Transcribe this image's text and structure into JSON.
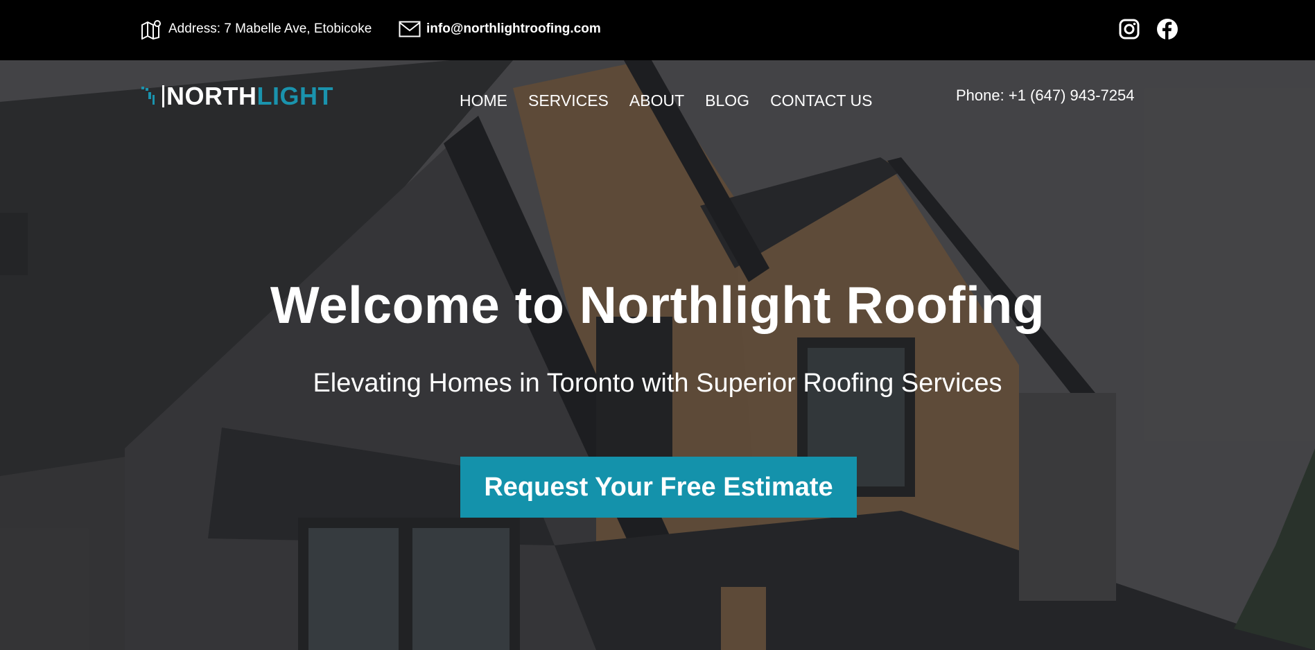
{
  "topbar": {
    "address": "Address: 7 Mabelle Ave, Etobicoke",
    "email": "info@northlightroofing.com",
    "social": [
      "instagram-icon",
      "facebook-icon"
    ]
  },
  "header": {
    "logo_part1": "NORTH",
    "logo_part2": "LIGHT",
    "nav": [
      "HOME",
      "SERVICES",
      "ABOUT",
      "BLOG",
      "CONTACT US"
    ],
    "phone": "Phone: +1 (647) 943-7254"
  },
  "hero": {
    "title": "Welcome to Northlight Roofing",
    "subtitle": "Elevating Homes in Toronto with Superior Roofing Services",
    "cta": "Request Your Free Estimate"
  },
  "colors": {
    "accent": "#1492ab",
    "logo_light": "#1a93ad",
    "topbar_bg": "#000000"
  }
}
